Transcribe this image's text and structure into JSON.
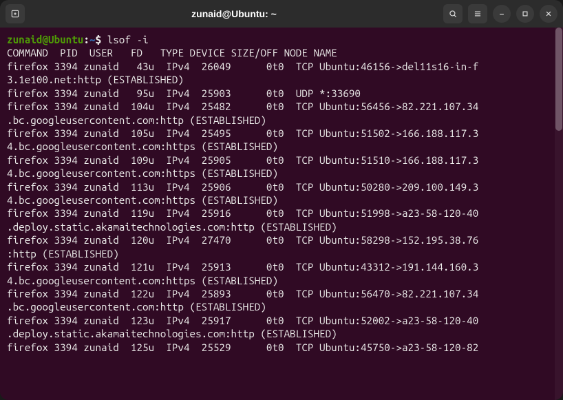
{
  "title": "zunaid@Ubuntu: ~",
  "prompt": {
    "userhost": "zunaid@Ubuntu",
    "sep": ":",
    "path": "~",
    "dollar": "$ "
  },
  "command": "lsof -i",
  "header": "COMMAND  PID  USER   FD   TYPE DEVICE SIZE/OFF NODE NAME",
  "lines": [
    "firefox 3394 zunaid   43u  IPv4  26049      0t0  TCP Ubuntu:46156->del11s16-in-f",
    "3.1e100.net:http (ESTABLISHED)",
    "firefox 3394 zunaid   95u  IPv4  25903      0t0  UDP *:33690",
    "firefox 3394 zunaid  104u  IPv4  25482      0t0  TCP Ubuntu:56456->82.221.107.34",
    ".bc.googleusercontent.com:http (ESTABLISHED)",
    "firefox 3394 zunaid  105u  IPv4  25495      0t0  TCP Ubuntu:51502->166.188.117.3",
    "4.bc.googleusercontent.com:https (ESTABLISHED)",
    "firefox 3394 zunaid  109u  IPv4  25905      0t0  TCP Ubuntu:51510->166.188.117.3",
    "4.bc.googleusercontent.com:https (ESTABLISHED)",
    "firefox 3394 zunaid  113u  IPv4  25906      0t0  TCP Ubuntu:50280->209.100.149.3",
    "4.bc.googleusercontent.com:https (ESTABLISHED)",
    "firefox 3394 zunaid  119u  IPv4  25916      0t0  TCP Ubuntu:51998->a23-58-120-40",
    ".deploy.static.akamaitechnologies.com:http (ESTABLISHED)",
    "firefox 3394 zunaid  120u  IPv4  27470      0t0  TCP Ubuntu:58298->152.195.38.76",
    ":http (ESTABLISHED)",
    "firefox 3394 zunaid  121u  IPv4  25913      0t0  TCP Ubuntu:43312->191.144.160.3",
    "4.bc.googleusercontent.com:https (ESTABLISHED)",
    "firefox 3394 zunaid  122u  IPv4  25893      0t0  TCP Ubuntu:56470->82.221.107.34",
    ".bc.googleusercontent.com:http (ESTABLISHED)",
    "firefox 3394 zunaid  123u  IPv4  25917      0t0  TCP Ubuntu:52002->a23-58-120-40",
    ".deploy.static.akamaitechnologies.com:http (ESTABLISHED)",
    "firefox 3394 zunaid  125u  IPv4  25529      0t0  TCP Ubuntu:45750->a23-58-120-82"
  ]
}
